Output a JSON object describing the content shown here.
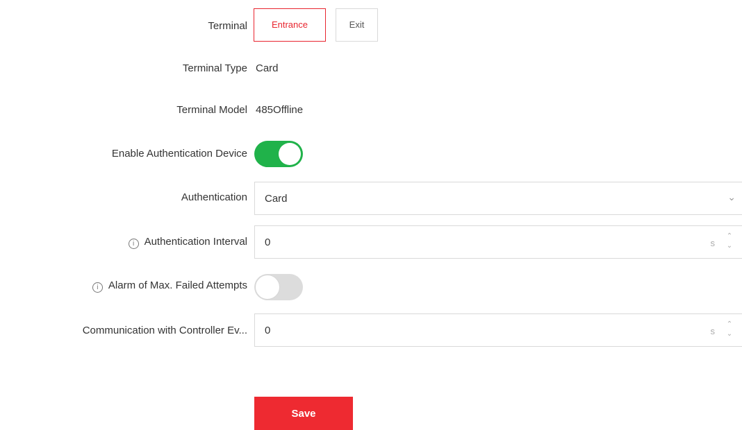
{
  "form": {
    "terminal": {
      "label": "Terminal",
      "options": [
        "Entrance",
        "Exit"
      ],
      "selected": "Entrance"
    },
    "terminal_type": {
      "label": "Terminal Type",
      "value": "Card"
    },
    "terminal_model": {
      "label": "Terminal Model",
      "value": "485Offline"
    },
    "enable_auth_device": {
      "label": "Enable Authentication Device",
      "state": "on"
    },
    "authentication": {
      "label": "Authentication",
      "value": "Card"
    },
    "auth_interval": {
      "label": "Authentication Interval",
      "value": "0",
      "unit": "s"
    },
    "alarm_failed": {
      "label": "Alarm of Max. Failed Attempts",
      "state": "off"
    },
    "comm_controller": {
      "label": "Communication with Controller Ev...",
      "value": "0",
      "unit": "s"
    }
  },
  "save_label": "Save",
  "colors": {
    "accent": "#e8242e",
    "toggle_on": "#20b24a",
    "toggle_off": "#dcdcdc",
    "save_bg": "#ee2a31"
  }
}
